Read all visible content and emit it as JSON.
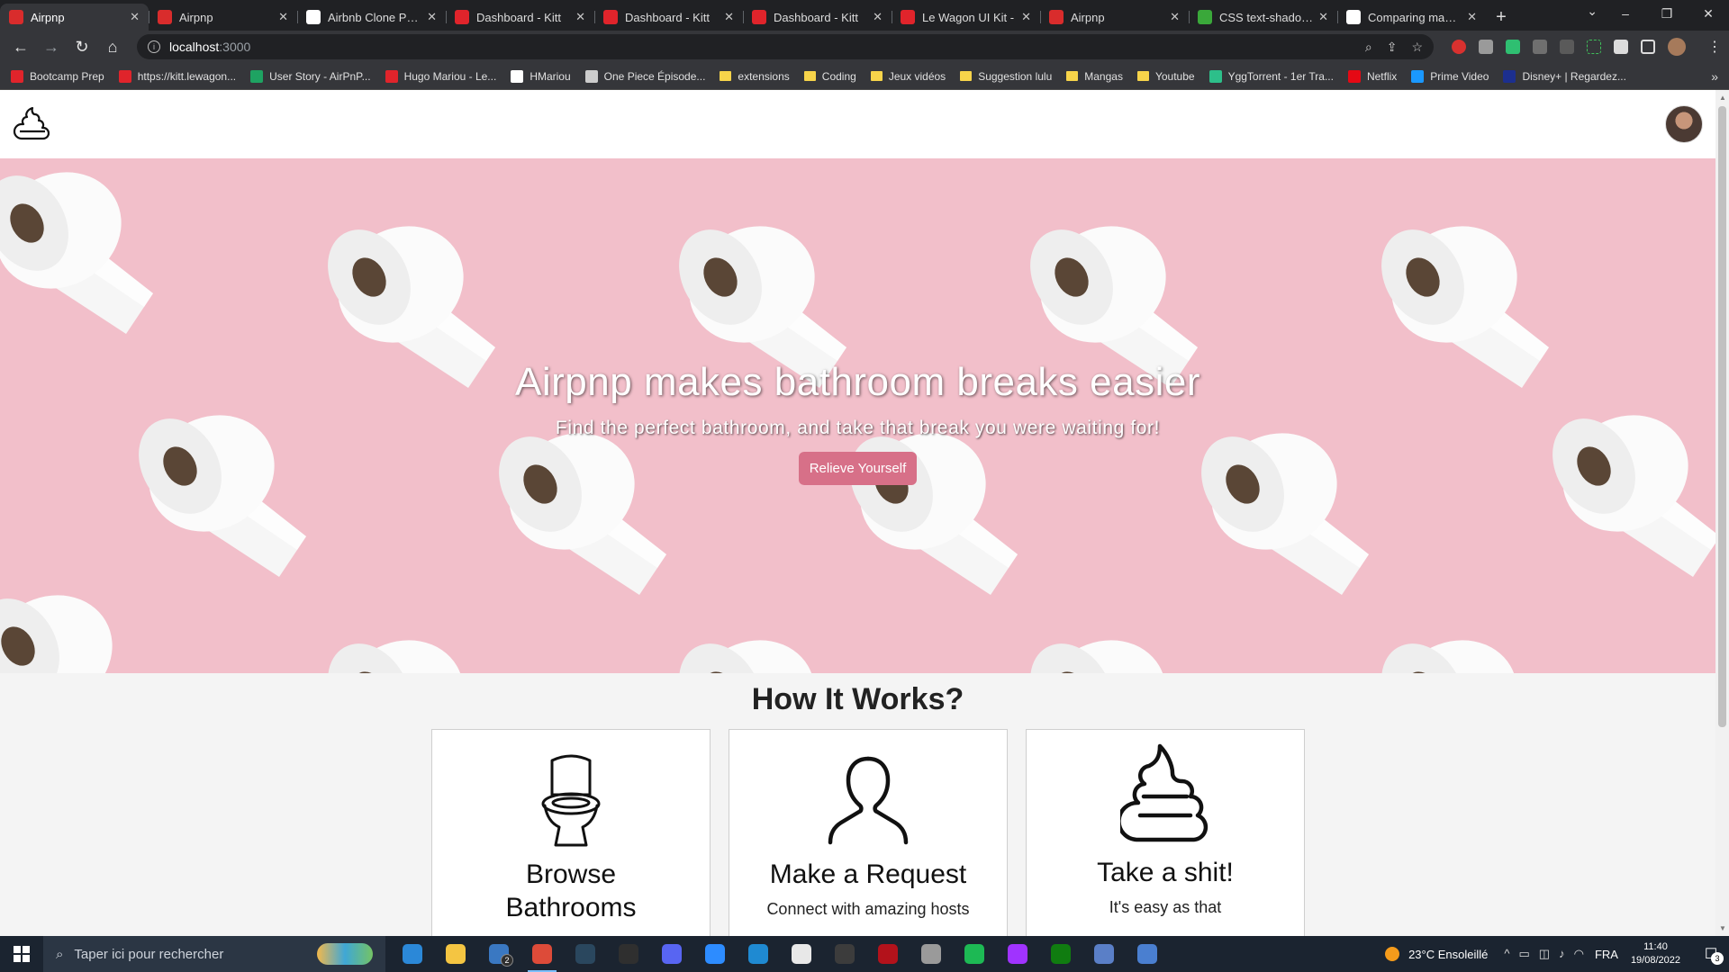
{
  "browser": {
    "tabs": [
      {
        "title": "Airpnp",
        "active": true,
        "favicon_color": "#d92c2c"
      },
      {
        "title": "Airpnp",
        "active": false,
        "favicon_color": "#d92c2c"
      },
      {
        "title": "Airbnb Clone Proje",
        "active": false,
        "favicon_color": "#ffffff"
      },
      {
        "title": "Dashboard - Kitt",
        "active": false,
        "favicon_color": "#e0242b"
      },
      {
        "title": "Dashboard - Kitt",
        "active": false,
        "favicon_color": "#e0242b"
      },
      {
        "title": "Dashboard - Kitt",
        "active": false,
        "favicon_color": "#e0242b"
      },
      {
        "title": "Le Wagon UI Kit -",
        "active": false,
        "favicon_color": "#e0242b"
      },
      {
        "title": "Airpnp",
        "active": false,
        "favicon_color": "#d92c2c"
      },
      {
        "title": "CSS text-shadow p",
        "active": false,
        "favicon_color": "#3aa83a"
      },
      {
        "title": "Comparing master",
        "active": false,
        "favicon_color": "#ffffff"
      }
    ],
    "new_tab_label": "+",
    "address": {
      "host": "localhost",
      "port": ":3000"
    },
    "bookmarks": [
      {
        "label": "Bootcamp Prep",
        "kind": "site",
        "color": "#e0242b"
      },
      {
        "label": "https://kitt.lewagon...",
        "kind": "site",
        "color": "#e0242b"
      },
      {
        "label": "User Story - AirPnP...",
        "kind": "site",
        "color": "#1ea362"
      },
      {
        "label": "Hugo Mariou - Le...",
        "kind": "site",
        "color": "#e0242b"
      },
      {
        "label": "HMariou",
        "kind": "site",
        "color": "#ffffff"
      },
      {
        "label": "One Piece Épisode...",
        "kind": "site",
        "color": "#cccccc"
      },
      {
        "label": "extensions",
        "kind": "folder"
      },
      {
        "label": "Coding",
        "kind": "folder"
      },
      {
        "label": "Jeux vidéos",
        "kind": "folder"
      },
      {
        "label": "Suggestion lulu",
        "kind": "folder"
      },
      {
        "label": "Mangas",
        "kind": "folder"
      },
      {
        "label": "Youtube",
        "kind": "folder"
      },
      {
        "label": "YggTorrent - 1er Tra...",
        "kind": "site",
        "color": "#2dbf8a"
      },
      {
        "label": "Netflix",
        "kind": "site",
        "color": "#e50914"
      },
      {
        "label": "Prime Video",
        "kind": "site",
        "color": "#1a98ff"
      },
      {
        "label": "Disney+ | Regardez...",
        "kind": "site",
        "color": "#1c2f8f"
      }
    ],
    "bookmarks_more": "»"
  },
  "site": {
    "hero": {
      "title": "Airpnp makes bathroom breaks easier",
      "subtitle": "Find the perfect bathroom, and take that break you were waiting for!",
      "cta": "Relieve Yourself",
      "background_color": "#f2bfca",
      "button_color": "#d77088"
    },
    "how": {
      "title": "How It Works?",
      "cards": [
        {
          "icon": "toilet-icon",
          "title": "Browse Bathrooms",
          "text": ""
        },
        {
          "icon": "user-icon",
          "title": "Make a Request",
          "text": "Connect with amazing hosts"
        },
        {
          "icon": "poop-icon",
          "title": "Take a shit!",
          "text": "It's easy as that"
        }
      ]
    }
  },
  "taskbar": {
    "search_placeholder": "Taper ici pour rechercher",
    "weather": "23°C  Ensoleillé",
    "language": "FRA",
    "time": "11:40",
    "date": "19/08/2022",
    "mail_badge": "2",
    "notif_badge": "3",
    "apps": [
      {
        "name": "store-icon",
        "color": "#2b88d8"
      },
      {
        "name": "explorer-icon",
        "color": "#f4c542"
      },
      {
        "name": "mail-icon",
        "color": "#3a78c2"
      },
      {
        "name": "chrome-icon",
        "color": "#dd4b39",
        "active": true
      },
      {
        "name": "steam-icon",
        "color": "#2a475e"
      },
      {
        "name": "epic-icon",
        "color": "#2f2f2f"
      },
      {
        "name": "discord-icon",
        "color": "#5865f2"
      },
      {
        "name": "zoom-icon",
        "color": "#2d8cff"
      },
      {
        "name": "vscode-icon",
        "color": "#1f8ad2"
      },
      {
        "name": "slack-icon",
        "color": "#e8e8e8"
      },
      {
        "name": "terminal-icon",
        "color": "#3c3c3c"
      },
      {
        "name": "app-red-icon",
        "color": "#b3121b"
      },
      {
        "name": "app-clock-icon",
        "color": "#9a9a9a"
      },
      {
        "name": "spotify-icon",
        "color": "#1db954"
      },
      {
        "name": "messenger-icon",
        "color": "#a033ff"
      },
      {
        "name": "xbox-icon",
        "color": "#107c10"
      },
      {
        "name": "app-diamond-icon",
        "color": "#5a7fc7"
      },
      {
        "name": "qbittorrent-icon",
        "color": "#4a7fd0"
      }
    ]
  }
}
